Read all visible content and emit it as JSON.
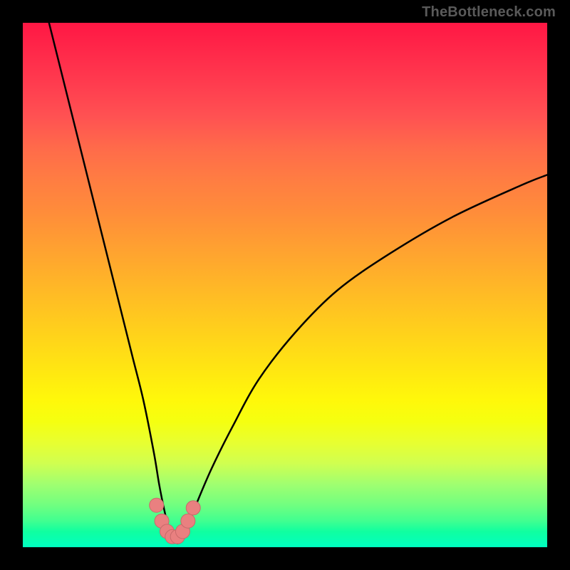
{
  "watermark": "TheBottleneck.com",
  "chart_data": {
    "type": "line",
    "title": "",
    "xlabel": "",
    "ylabel": "",
    "xlim": [
      0,
      100
    ],
    "ylim": [
      0,
      100
    ],
    "series": [
      {
        "name": "curve",
        "x": [
          5,
          7,
          9,
          11,
          13,
          15,
          17,
          19,
          21,
          23,
          25,
          26,
          27,
          28,
          29,
          30,
          31,
          33,
          36,
          40,
          45,
          52,
          60,
          70,
          82,
          95,
          100
        ],
        "values": [
          100,
          92,
          84,
          76,
          68,
          60,
          52,
          44,
          36,
          28,
          18,
          12,
          7,
          3,
          1,
          1,
          3,
          8,
          15,
          23,
          32,
          41,
          49,
          56,
          63,
          69,
          71
        ]
      }
    ],
    "points": {
      "name": "highlight",
      "x": [
        25.5,
        26.5,
        27.5,
        28.5,
        29.5,
        30.5,
        31.5,
        32.5
      ],
      "values": [
        8,
        5,
        3,
        2,
        2,
        3,
        5,
        7.5
      ]
    },
    "colors": {
      "curve": "#000000",
      "point_fill": "#e98080",
      "point_stroke": "#c86a6a"
    }
  }
}
